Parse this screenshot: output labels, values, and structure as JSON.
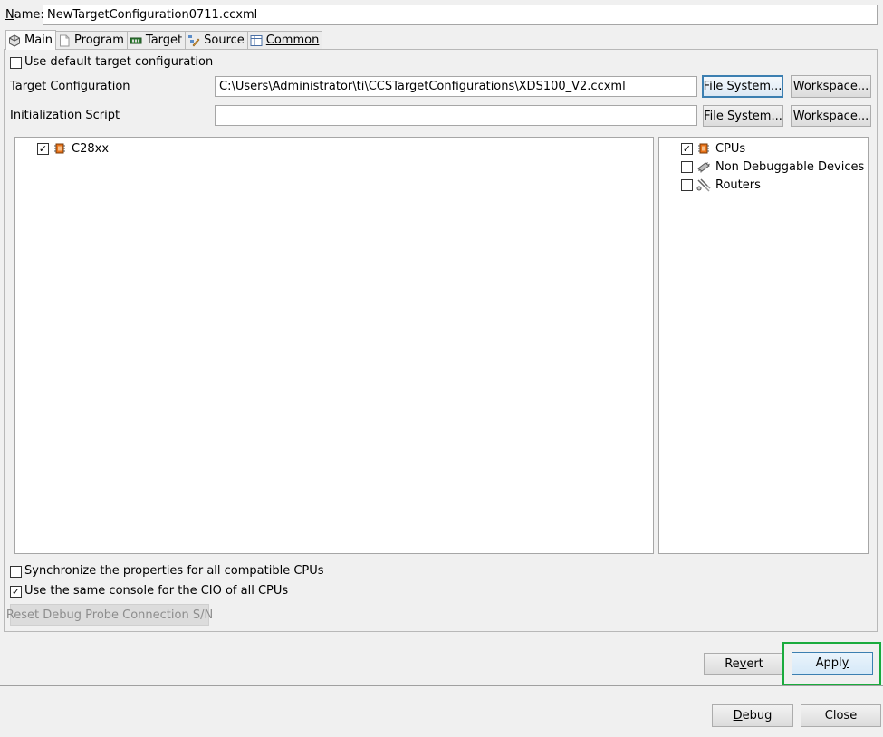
{
  "name_field": {
    "label_first": "N",
    "label_rest": "ame:",
    "value": "NewTargetConfiguration0711.ccxml"
  },
  "tabs": [
    {
      "label": "Main",
      "icon": "gear-cube-icon",
      "active": true
    },
    {
      "label": "Program",
      "icon": "document-icon",
      "active": false
    },
    {
      "label": "Target",
      "icon": "board-icon",
      "active": false
    },
    {
      "label": "Source",
      "icon": "source-lookup-icon",
      "active": false
    },
    {
      "label": "Common",
      "icon": "table-icon",
      "active": false
    }
  ],
  "main": {
    "use_default_label": "Use default target configuration",
    "target_config_label": "Target Configuration",
    "target_config_value": "C:\\Users\\Administrator\\ti\\CCSTargetConfigurations\\XDS100_V2.ccxml",
    "init_script_label": "Initialization Script",
    "init_script_value": "",
    "file_system_label": "File System...",
    "workspace_label": "Workspace...",
    "cpu_tree": [
      {
        "label": "C28xx",
        "checked": true,
        "icon": "cpu-chip-icon"
      }
    ],
    "filter_tree": [
      {
        "label": "CPUs",
        "checked": true,
        "icon": "cpu-chip-icon"
      },
      {
        "label": "Non Debuggable Devices",
        "checked": false,
        "icon": "chip-icon"
      },
      {
        "label": "Routers",
        "checked": false,
        "icon": "router-icon"
      }
    ],
    "sync_props_label": "Synchronize the properties for all compatible CPUs",
    "sync_props_checked": false,
    "same_console_label": "Use the same console for the CIO of all CPUs",
    "same_console_checked": true,
    "reset_probe_label": "Reset Debug Probe Connection S/N"
  },
  "footer": {
    "revert_label_pre": "Re",
    "revert_label_u": "v",
    "revert_label_post": "ert",
    "apply_label_pre": "Appl",
    "apply_label_u": "y",
    "debug_label_u": "D",
    "debug_label_post": "ebug",
    "close_label": "Close"
  },
  "colors": {
    "highlight": "#1aab3d",
    "focus": "#3c7fb1"
  }
}
